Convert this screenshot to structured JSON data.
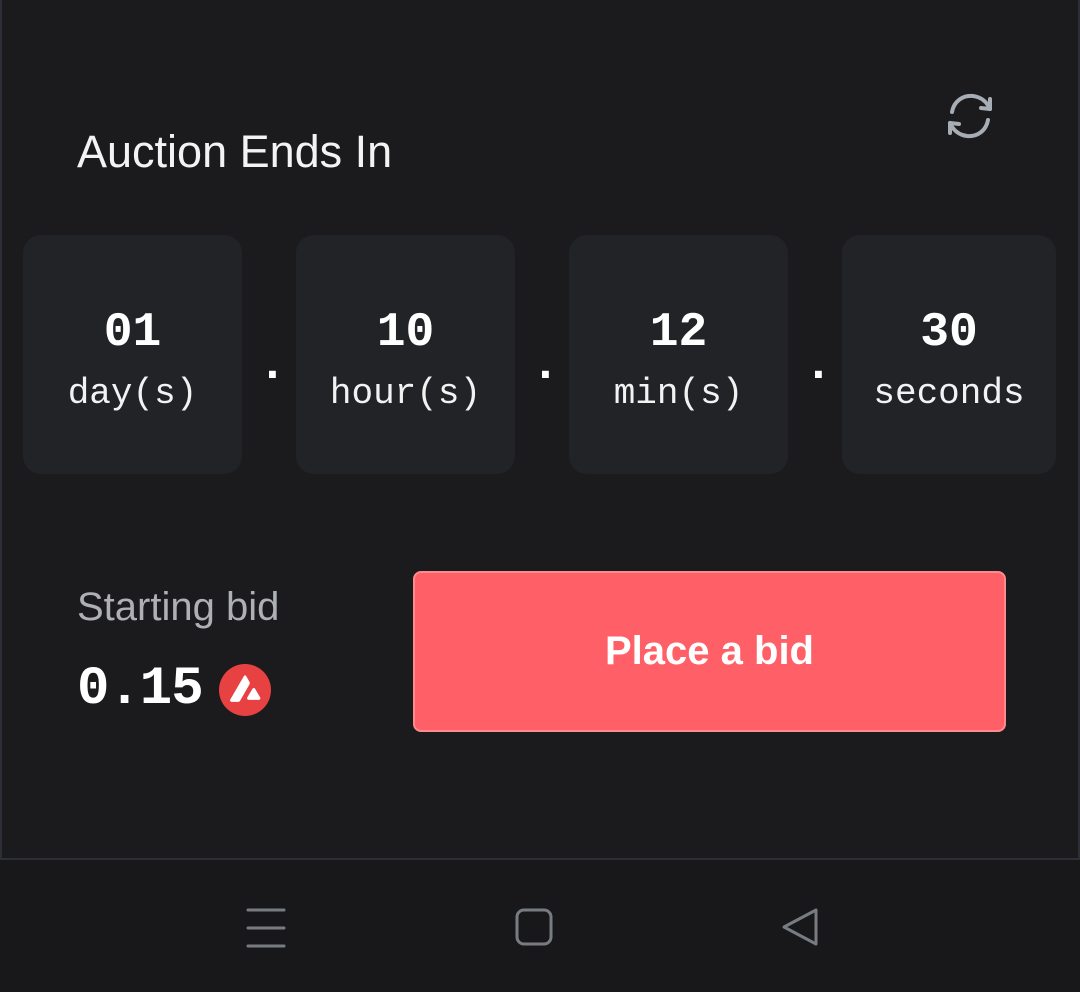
{
  "auction": {
    "title": "Auction Ends In"
  },
  "countdown": {
    "days": {
      "value": "01",
      "unit": "day(s)"
    },
    "hours": {
      "value": "10",
      "unit": "hour(s)"
    },
    "minutes": {
      "value": "12",
      "unit": "min(s)"
    },
    "seconds": {
      "value": "30",
      "unit": "seconds"
    },
    "separator": "."
  },
  "bid": {
    "starting_label": "Starting bid",
    "amount": "0.15",
    "currency_icon": "avax-icon",
    "button_label": "Place a bid"
  },
  "icons": {
    "refresh": "refresh-icon",
    "menu": "menu-icon",
    "home": "home-icon",
    "back": "back-icon"
  },
  "colors": {
    "background": "#1b1b1d",
    "tile": "#212327",
    "accent": "#ff5f67",
    "muted_text": "#aeb0b4",
    "icon_gray": "#a6adb5"
  }
}
